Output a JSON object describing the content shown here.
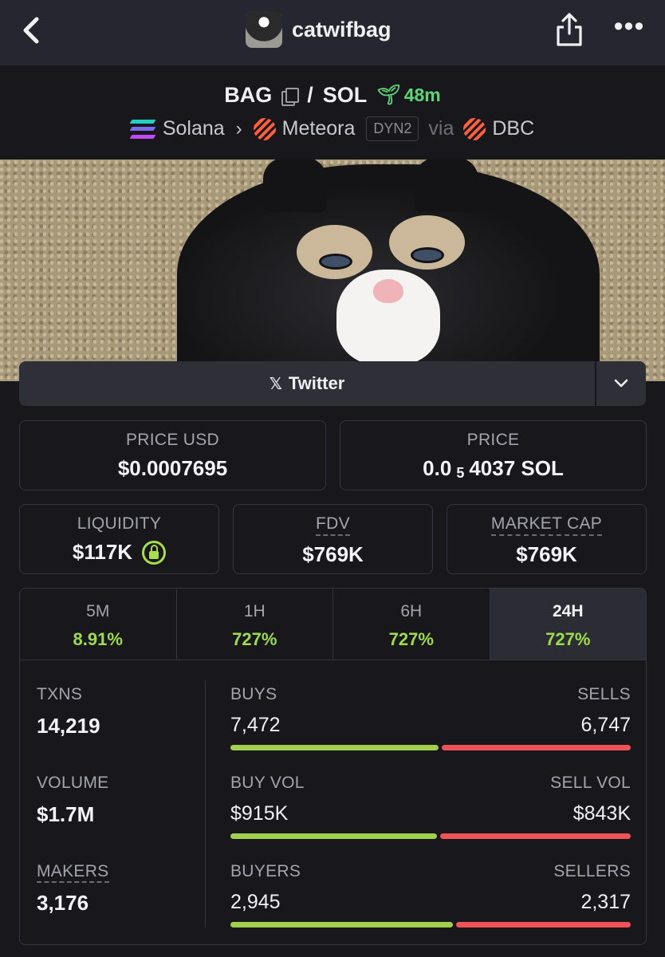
{
  "header": {
    "title": "catwifbag",
    "back_icon": "chevron-left-icon",
    "share_icon": "share-icon",
    "more_icon": "more-dots-icon",
    "more_glyph": "•••"
  },
  "pair": {
    "base": "BAG",
    "separator": "/",
    "quote": "SOL",
    "age": "48m",
    "chain": "Solana",
    "dex": "Meteora",
    "badge": "DYN2",
    "via_label": "via",
    "launchpad": "DBC",
    "chevron": "›"
  },
  "links": {
    "twitter_label": "Twitter",
    "twitter_glyph": "𝕏"
  },
  "stats": {
    "price_usd_label": "PRICE USD",
    "price_usd": "$0.0007695",
    "price_label": "PRICE",
    "price_prefix": "0.0",
    "price_sub": "5",
    "price_suffix": "4037 SOL",
    "liquidity_label": "LIQUIDITY",
    "liquidity": "$117K",
    "fdv_label": "FDV",
    "fdv": "$769K",
    "mcap_label": "MARKET CAP",
    "mcap": "$769K"
  },
  "timeframes": [
    {
      "label": "5M",
      "change": "8.91%"
    },
    {
      "label": "1H",
      "change": "727%"
    },
    {
      "label": "6H",
      "change": "727%"
    },
    {
      "label": "24H",
      "change": "727%"
    }
  ],
  "activity": {
    "txns_label": "TXNS",
    "txns": "14,219",
    "buys_label": "BUYS",
    "buys": "7,472",
    "sells_label": "SELLS",
    "sells": "6,747",
    "buys_fraction": 0.525,
    "volume_label": "VOLUME",
    "volume": "$1.7M",
    "buy_vol_label": "BUY VOL",
    "buy_vol": "$915K",
    "sell_vol_label": "SELL VOL",
    "sell_vol": "$843K",
    "buy_vol_fraction": 0.52,
    "makers_label": "MAKERS",
    "makers": "3,176",
    "buyers_label": "BUYERS",
    "buyers": "2,945",
    "sellers_label": "SELLERS",
    "sellers": "2,317",
    "buyers_fraction": 0.56
  },
  "colors": {
    "positive": "#9fdc4a",
    "negative": "#f0525a",
    "age": "#5fd47a"
  }
}
